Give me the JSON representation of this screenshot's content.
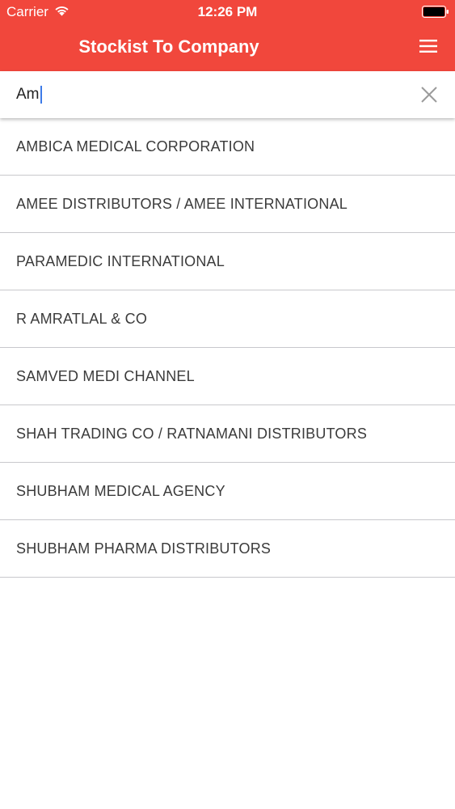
{
  "status_bar": {
    "carrier": "Carrier",
    "time": "12:26 PM",
    "wifi_icon": "wifi-icon",
    "battery_icon": "battery-icon"
  },
  "header": {
    "title": "Stockist To Company",
    "background": "#f1473c",
    "menu_icon": "hamburger-menu-icon"
  },
  "search": {
    "value": "Am",
    "clear_icon": "close-icon"
  },
  "results": [
    "AMBICA MEDICAL CORPORATION",
    "AMEE DISTRIBUTORS / AMEE INTERNATIONAL",
    "PARAMEDIC INTERNATIONAL",
    "R AMRATLAL & CO",
    "SAMVED MEDI CHANNEL",
    "SHAH TRADING CO / RATNAMANI DISTRIBUTORS",
    "SHUBHAM MEDICAL AGENCY",
    "SHUBHAM PHARMA DISTRIBUTORS"
  ]
}
